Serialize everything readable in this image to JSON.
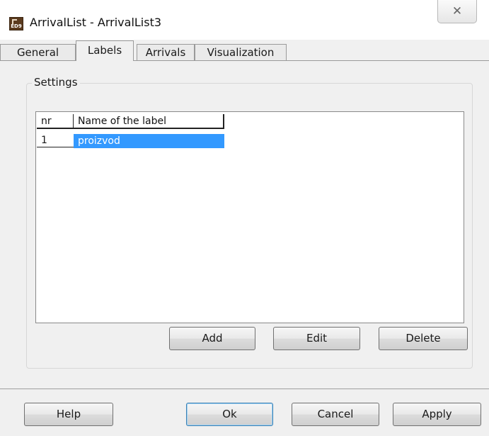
{
  "window": {
    "title": "ArrivalList - ArrivalList3",
    "icon": "ed9-app-icon",
    "icon_text": "ED9",
    "close_glyph": "✕"
  },
  "tabs": [
    {
      "label": "General",
      "active": false
    },
    {
      "label": "Labels",
      "active": true
    },
    {
      "label": "Arrivals",
      "active": false
    },
    {
      "label": "Visualization",
      "active": false
    }
  ],
  "settings": {
    "legend": "Settings",
    "table": {
      "columns": [
        "nr",
        "Name of the label"
      ],
      "rows": [
        {
          "nr": "1",
          "name": "proizvod",
          "selected": true
        }
      ]
    },
    "buttons": {
      "add": "Add",
      "edit": "Edit",
      "delete": "Delete"
    }
  },
  "footer": {
    "help": "Help",
    "ok": "Ok",
    "cancel": "Cancel",
    "apply": "Apply"
  },
  "colors": {
    "selection": "#3399ff",
    "background": "#f0f0f0"
  }
}
